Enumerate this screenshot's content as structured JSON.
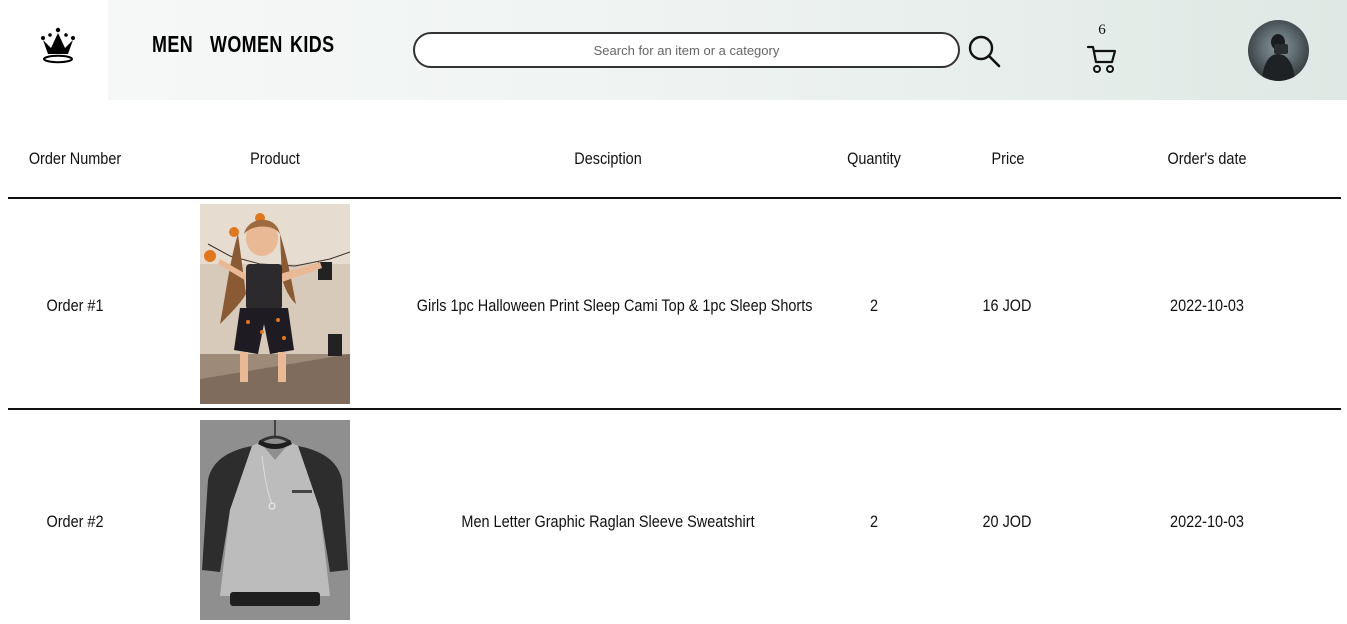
{
  "nav": {
    "links": [
      "MEN",
      "WOMEN",
      "KIDS"
    ]
  },
  "search": {
    "placeholder": "Search for an item or a category"
  },
  "cart": {
    "count": "6"
  },
  "icons": {
    "logo": "crown-icon",
    "search": "search-icon",
    "cart": "cart-icon",
    "avatar": "user-avatar"
  },
  "table": {
    "headers": [
      "Order Number",
      "Product",
      "Desciption",
      "Quantity",
      "Price",
      "Order's date"
    ],
    "rows": [
      {
        "order": "Order #1",
        "product_image": "girls-halloween-pajama-photo",
        "description": "Girls 1pc Halloween Print Sleep Cami Top & 1pc Sleep Shorts",
        "quantity": "2",
        "price": "16 JOD",
        "date": "2022-10-03"
      },
      {
        "order": "Order #2",
        "product_image": "men-raglan-sweatshirt-photo",
        "description": "Men Letter Graphic Raglan Sleeve Sweatshirt",
        "quantity": "2",
        "price": "20 JOD",
        "date": "2022-10-03"
      }
    ]
  }
}
